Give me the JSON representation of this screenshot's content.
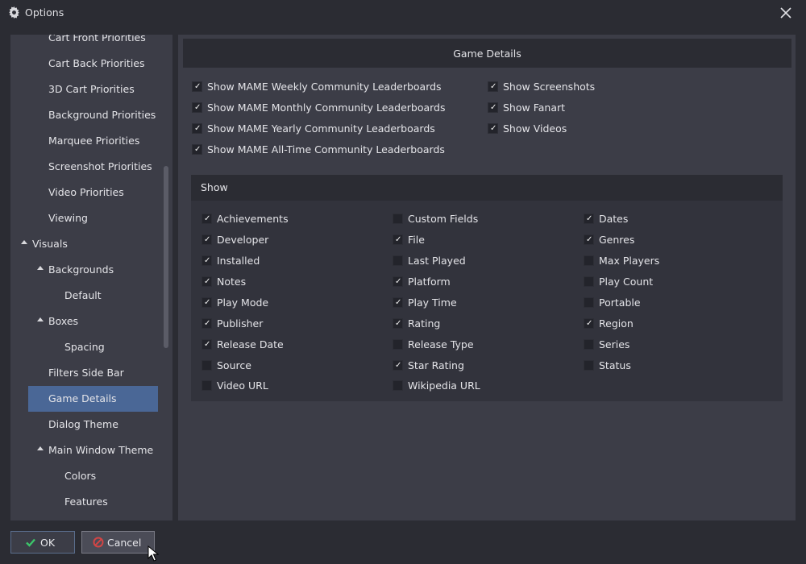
{
  "window": {
    "title": "Options",
    "close_icon": "close-icon",
    "app_icon": "gear-icon"
  },
  "sidebar": {
    "items": [
      {
        "label": "Cart Front Priorities",
        "level": 2
      },
      {
        "label": "Cart Back Priorities",
        "level": 2
      },
      {
        "label": "3D Cart Priorities",
        "level": 2
      },
      {
        "label": "Background Priorities",
        "level": 2
      },
      {
        "label": "Marquee Priorities",
        "level": 2
      },
      {
        "label": "Screenshot Priorities",
        "level": 2
      },
      {
        "label": "Video Priorities",
        "level": 2
      },
      {
        "label": "Viewing",
        "level": 2
      },
      {
        "label": "Visuals",
        "level": 1,
        "expanded": true
      },
      {
        "label": "Backgrounds",
        "level": 2,
        "expanded": true
      },
      {
        "label": "Default",
        "level": 3
      },
      {
        "label": "Boxes",
        "level": 2,
        "expanded": true
      },
      {
        "label": "Spacing",
        "level": 3
      },
      {
        "label": "Filters Side Bar",
        "level": 2
      },
      {
        "label": "Game Details",
        "level": 2,
        "selected": true
      },
      {
        "label": "Dialog Theme",
        "level": 2
      },
      {
        "label": "Main Window Theme",
        "level": 2,
        "expanded": true
      },
      {
        "label": "Colors",
        "level": 3
      },
      {
        "label": "Features",
        "level": 3
      }
    ]
  },
  "game_details": {
    "header": "Game Details",
    "options_left": [
      {
        "label": "Show MAME Weekly Community Leaderboards",
        "checked": true
      },
      {
        "label": "Show MAME Monthly Community Leaderboards",
        "checked": true
      },
      {
        "label": "Show MAME Yearly Community Leaderboards",
        "checked": true
      },
      {
        "label": "Show MAME All-Time Community Leaderboards",
        "checked": true
      }
    ],
    "options_right": [
      {
        "label": "Show Screenshots",
        "checked": true
      },
      {
        "label": "Show Fanart",
        "checked": true
      },
      {
        "label": "Show Videos",
        "checked": true
      }
    ]
  },
  "show": {
    "header": "Show",
    "columns": [
      [
        {
          "label": "Achievements",
          "checked": true
        },
        {
          "label": "Developer",
          "checked": true
        },
        {
          "label": "Installed",
          "checked": true
        },
        {
          "label": "Notes",
          "checked": true
        },
        {
          "label": "Play Mode",
          "checked": true
        },
        {
          "label": "Publisher",
          "checked": true
        },
        {
          "label": "Release Date",
          "checked": true
        },
        {
          "label": "Source",
          "checked": false
        },
        {
          "label": "Video URL",
          "checked": false
        }
      ],
      [
        {
          "label": "Custom Fields",
          "checked": false
        },
        {
          "label": "File",
          "checked": true
        },
        {
          "label": "Last Played",
          "checked": false
        },
        {
          "label": "Platform",
          "checked": true
        },
        {
          "label": "Play Time",
          "checked": true
        },
        {
          "label": "Rating",
          "checked": true
        },
        {
          "label": "Release Type",
          "checked": false
        },
        {
          "label": "Star Rating",
          "checked": true
        },
        {
          "label": "Wikipedia URL",
          "checked": false
        }
      ],
      [
        {
          "label": "Dates",
          "checked": true
        },
        {
          "label": "Genres",
          "checked": true
        },
        {
          "label": "Max Players",
          "checked": false
        },
        {
          "label": "Play Count",
          "checked": false
        },
        {
          "label": "Portable",
          "checked": false
        },
        {
          "label": "Region",
          "checked": true
        },
        {
          "label": "Series",
          "checked": false
        },
        {
          "label": "Status",
          "checked": false
        }
      ]
    ]
  },
  "buttons": {
    "ok_label": "OK",
    "cancel_label": "Cancel"
  },
  "colors": {
    "selected": "#4a6796",
    "ok_icon": "#3cc46a",
    "cancel_icon": "#d24545"
  }
}
